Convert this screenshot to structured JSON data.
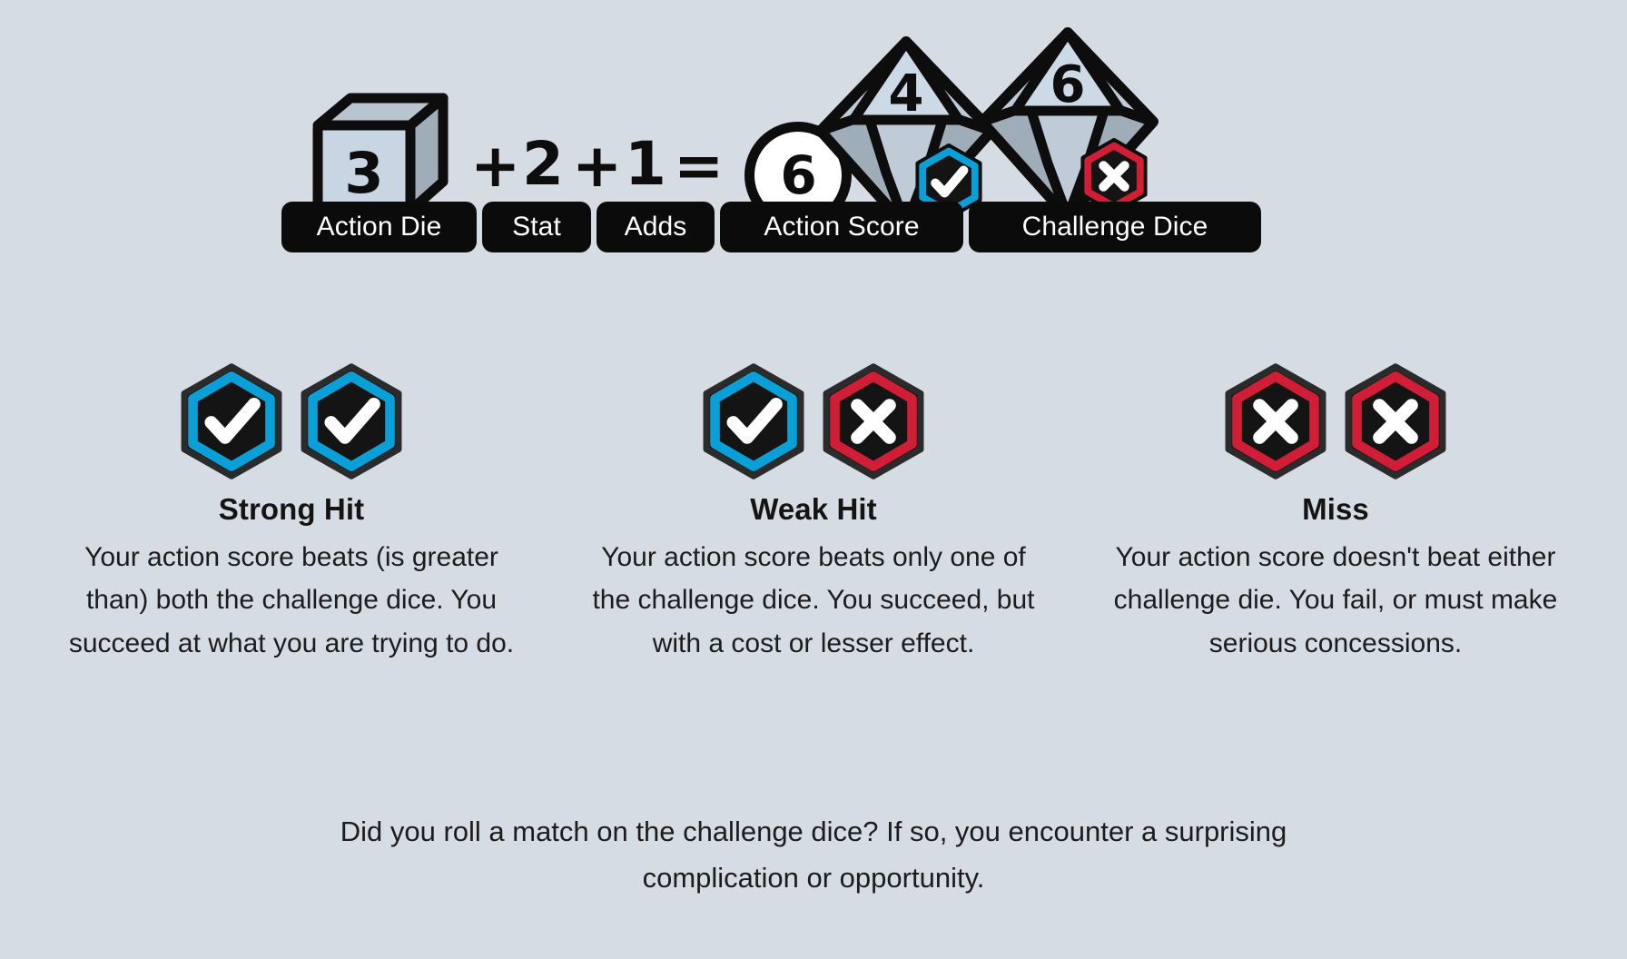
{
  "colors": {
    "background": "#d5dce3",
    "ink": "#0d0d0d",
    "pill_bg": "#0b0b0b",
    "pill_text": "#ffffff",
    "hit_blue": "#0b9fd8",
    "miss_red": "#d01e36",
    "badge_fill": "#141414",
    "badge_outline": "#2b2b2b",
    "die_face_light": "#c8d6e4",
    "die_face_mid": "#9fadb9",
    "die_face_dark": "#8e9ba7"
  },
  "formula": {
    "action_die_value": "3",
    "operator_plus_1": "+",
    "stat_value": "2",
    "operator_plus_2": "+",
    "adds_value": "1",
    "operator_equals": "=",
    "action_score_value": "6",
    "challenge_die_1_value": "4",
    "challenge_die_1_marker": "check",
    "challenge_die_2_value": "6",
    "challenge_die_2_marker": "cross"
  },
  "pills": [
    {
      "id": "action-die",
      "label": "Action Die"
    },
    {
      "id": "stat",
      "label": "Stat"
    },
    {
      "id": "adds",
      "label": "Adds"
    },
    {
      "id": "action-score",
      "label": "Action Score"
    },
    {
      "id": "challenge",
      "label": "Challenge Dice"
    }
  ],
  "outcomes": [
    {
      "id": "strong-hit",
      "title": "Strong Hit",
      "description": "Your action score beats (is greater than) both the challenge dice. You succeed at what you are trying to do.",
      "badges": [
        "check",
        "check"
      ]
    },
    {
      "id": "weak-hit",
      "title": "Weak Hit",
      "description": "Your action score beats only one of the challenge dice. You succeed, but with a cost or lesser effect.",
      "badges": [
        "check",
        "cross"
      ]
    },
    {
      "id": "miss",
      "title": "Miss",
      "description": "Your action score doesn't beat either challenge die. You fail, or must make serious concessions.",
      "badges": [
        "cross",
        "cross"
      ]
    }
  ],
  "footer": {
    "note": "Did you roll a match on the challenge dice? If so, you encounter a surprising complication or opportunity."
  }
}
